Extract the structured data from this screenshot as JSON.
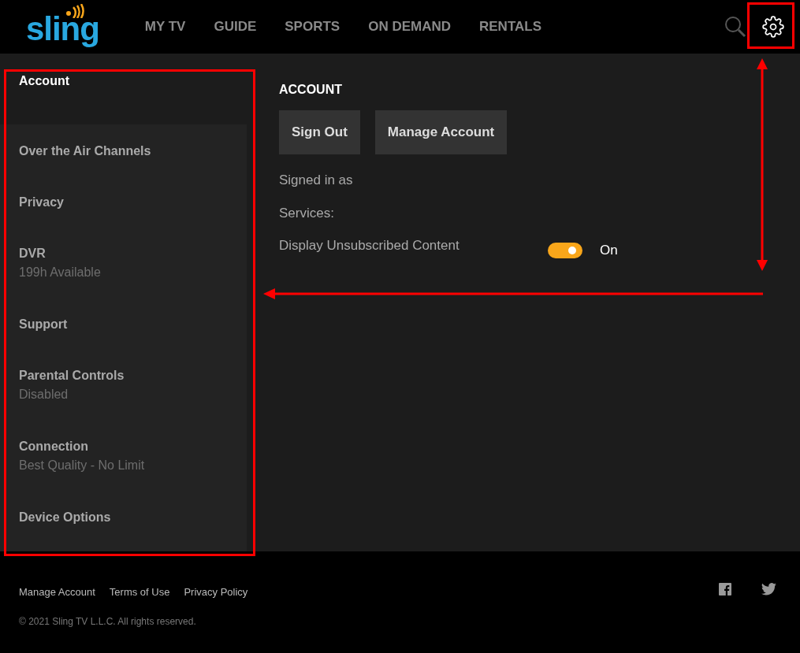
{
  "header": {
    "logo": "sling",
    "nav": [
      "MY TV",
      "GUIDE",
      "SPORTS",
      "ON DEMAND",
      "RENTALS"
    ]
  },
  "sidebar": {
    "items": [
      {
        "label": "Account",
        "selected": true
      },
      {
        "label": "Over the Air Channels",
        "selected": false
      },
      {
        "label": "Privacy",
        "selected": false
      },
      {
        "label": "DVR",
        "detail": "199h Available",
        "selected": false
      },
      {
        "label": "Support",
        "selected": false
      },
      {
        "label": "Parental Controls",
        "detail": "Disabled",
        "selected": false
      },
      {
        "label": "Connection",
        "detail": "Best Quality - No Limit",
        "selected": false
      },
      {
        "label": "Device Options",
        "selected": false
      }
    ]
  },
  "account": {
    "title": "ACCOUNT",
    "buttons": [
      "Sign Out",
      "Manage Account"
    ],
    "signed_in": "Signed in as",
    "services": "Services:",
    "setting": {
      "label": "Display Unsubscribed Content",
      "on": true,
      "state_text": "On"
    }
  },
  "footer": {
    "links": [
      "Manage Account",
      "Terms of Use",
      "Privacy Policy"
    ],
    "copyright": "© 2021 Sling TV L.L.C. All rights reserved."
  }
}
